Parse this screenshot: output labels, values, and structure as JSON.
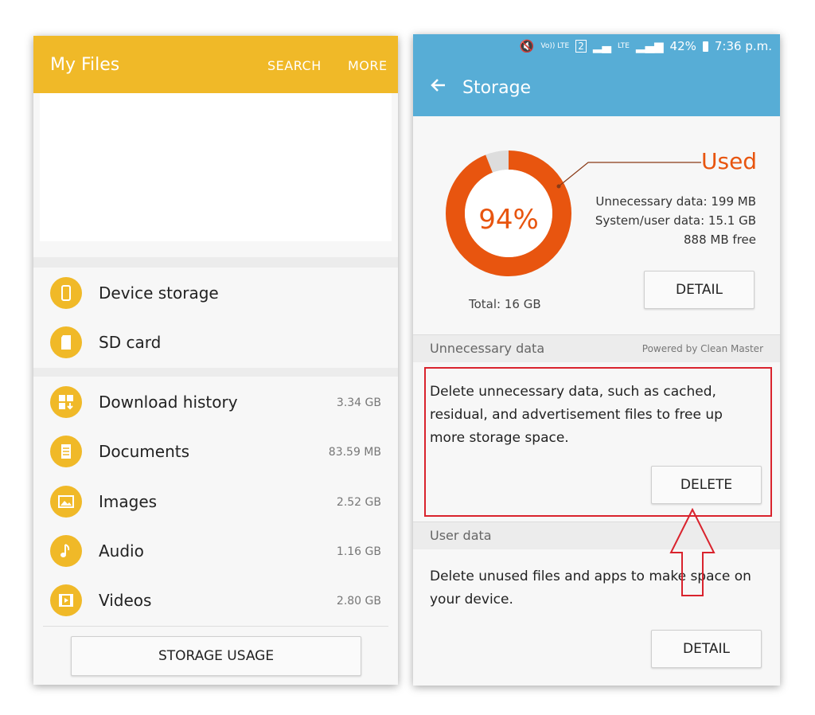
{
  "left": {
    "header": {
      "title": "My Files",
      "search_label": "SEARCH",
      "more_label": "MORE"
    },
    "locations": [
      {
        "label": "Device storage",
        "icon": "phone-icon"
      },
      {
        "label": "SD card",
        "icon": "sd-card-icon"
      }
    ],
    "categories": [
      {
        "label": "Download history",
        "size": "3.34 GB",
        "icon": "download-icon"
      },
      {
        "label": "Documents",
        "size": "83.59 MB",
        "icon": "document-icon"
      },
      {
        "label": "Images",
        "size": "2.52 GB",
        "icon": "image-icon"
      },
      {
        "label": "Audio",
        "size": "1.16 GB",
        "icon": "music-note-icon"
      },
      {
        "label": "Videos",
        "size": "2.80 GB",
        "icon": "film-icon"
      }
    ],
    "storage_usage_button": "STORAGE USAGE"
  },
  "right": {
    "status_bar": {
      "volte": "Vo)) LTE",
      "sim": "2",
      "lte": "LTE",
      "battery": "42%",
      "time": "7:36 p.m."
    },
    "header": {
      "title": "Storage"
    },
    "summary": {
      "used_percent": "94%",
      "used_fraction": 0.94,
      "used_label": "Used",
      "unnecessary": "Unnecessary data: 199 MB",
      "system_user": "System/user data: 15.1 GB",
      "free": "888 MB free",
      "total": "Total: 16 GB",
      "detail_button": "DETAIL"
    },
    "unnecessary_section": {
      "title": "Unnecessary data",
      "powered_by": "Powered by Clean Master",
      "description": "Delete unnecessary data, such as cached, residual, and advertisement files to free up more storage space.",
      "delete_button": "DELETE"
    },
    "user_section": {
      "title": "User data",
      "description": "Delete unused files and apps to make space on your device.",
      "detail_button": "DETAIL"
    }
  },
  "colors": {
    "my_files_header": "#f0b928",
    "storage_header": "#57add6",
    "used_orange": "#e8550f",
    "highlight_red": "#d9232d"
  }
}
